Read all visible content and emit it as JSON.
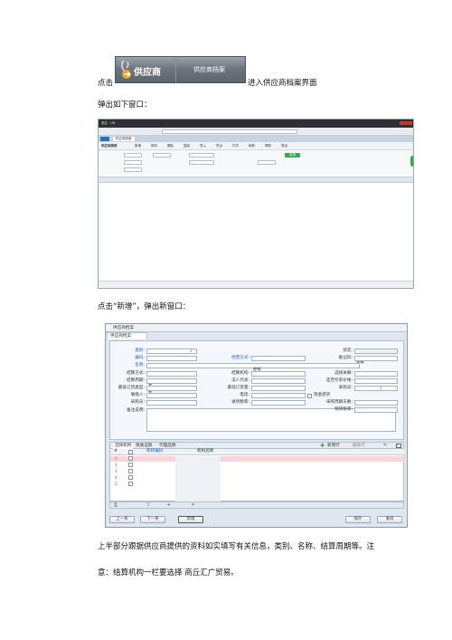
{
  "banner": {
    "title": "供应商",
    "subtitle": "供应商档案"
  },
  "lines": {
    "click_prefix": "点击",
    "enter_suffix": "进入供应商档案界面",
    "popup_window": "弹出如下窗口：",
    "click_new": "点击“新增”，弹出新窗口：",
    "para_upper": "上半部分跟据供应商提供的资料如实填写有关信息，类别、名称、结算周期等。注",
    "para_note": "意：结算机构一栏要选择 商丘汇广贸易。"
  },
  "shot1": {
    "window_title": "用友 · U8",
    "tab_label": "供应商档案",
    "page_title": "供应商档案",
    "query_button": "查询",
    "toolbar_items": [
      "新增",
      "修改",
      "删除",
      "复制",
      "导入",
      "导出",
      "打印",
      "刷新",
      "帮助",
      "退出"
    ]
  },
  "shot2": {
    "window_title": "供应商档案",
    "tab_label": "供应商档案",
    "fields_left": [
      {
        "label": "类别:",
        "value": "",
        "blue": true
      },
      {
        "label": "编码:",
        "value": "",
        "blue": true
      },
      {
        "label": "名称:",
        "value": "",
        "blue": true
      },
      {
        "label": "结算方式:",
        "value": "无",
        "blue": false
      },
      {
        "label": "结算周期:",
        "value": "无",
        "blue": false
      },
      {
        "label": "最低订货类型:",
        "value": "",
        "blue": false
      },
      {
        "label": "联络人:",
        "value": "",
        "blue": false
      },
      {
        "label": "采购员:",
        "value": "",
        "blue": false
      },
      {
        "label": "备注说明:",
        "value": "",
        "blue": false
      }
    ],
    "fields_mid": [
      {
        "label": "经营方式:",
        "value": "经销",
        "blue": true
      },
      {
        "label": "结算机构:",
        "value": "",
        "blue": false
      },
      {
        "label": "法人代表:",
        "value": "",
        "blue": false
      },
      {
        "label": "最低订货量:",
        "value": "",
        "blue": false
      },
      {
        "label": "电话:",
        "value": "",
        "blue": false
      },
      {
        "label": "进项税率:",
        "value": "",
        "blue": false
      }
    ],
    "fields_right": [
      {
        "label": "状态:",
        "value": "草稿",
        "blue": false
      },
      {
        "label": "助记码:",
        "value": "",
        "blue": false
      },
      {
        "label": "选择关联:",
        "value": "",
        "blue": false
      },
      {
        "label": "是否引单价格:",
        "value": "",
        "blue": false
      },
      {
        "label": "采购员:",
        "value": "",
        "blue": false
      },
      {
        "label": "现金欲买",
        "value": "",
        "blue": false
      },
      {
        "label": "采购周期天数:",
        "value": "",
        "blue": false
      },
      {
        "label": "销项税率:",
        "value": "",
        "blue": false
      }
    ],
    "grid_tabs": [
      "选择机构",
      "资质证照",
      "代理品牌"
    ],
    "grid_actions": [
      "新增行",
      "删除行"
    ],
    "grid_headers": [
      "#",
      "机构编码",
      "机构名称"
    ],
    "grid_rows": [
      "1",
      "2",
      "3",
      "4",
      "5"
    ],
    "buttons": {
      "prev": "上一条",
      "next": "下一条",
      "new": "新增",
      "save": "保存",
      "close": "关闭"
    }
  }
}
